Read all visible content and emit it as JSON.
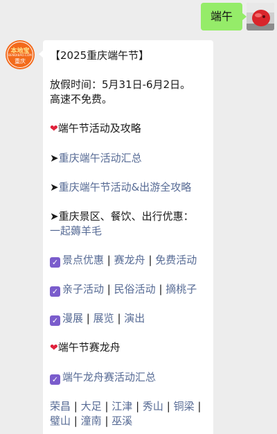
{
  "outgoing": {
    "text": "端午"
  },
  "sender": {
    "logo_top": "本地宝",
    "logo_mid": "BENDIBAO.COM",
    "logo_bot": "重庆"
  },
  "message": {
    "title": "【2025重庆端午节】",
    "holiday_line1": "放假时间：5月31日-6月2日。",
    "holiday_line2": "高速不免费。",
    "section1_heart": "❤",
    "section1_title": "端午节活动及攻略",
    "arrow": "➤",
    "link1": "重庆端午活动汇总",
    "link2": "重庆端午节活动&出游全攻略",
    "discount_label": "重庆景区、餐饮、出行优惠：",
    "discount_link": "一起薅羊毛",
    "check": "✓",
    "row1": [
      "景点优惠",
      "赛龙舟",
      "免费活动"
    ],
    "row2": [
      "亲子活动",
      "民俗活动",
      "摘桃子"
    ],
    "row3": [
      "漫展",
      "展览",
      "演出"
    ],
    "section2_heart": "❤",
    "section2_title": "端午节赛龙舟",
    "dragon_link": "端午龙舟赛活动汇总",
    "districts_line1": [
      "荣昌",
      "大足",
      "江津",
      "秀山",
      "铜梁"
    ],
    "districts_line2": [
      "璧山",
      "潼南",
      "巫溪"
    ],
    "separator": "|"
  }
}
